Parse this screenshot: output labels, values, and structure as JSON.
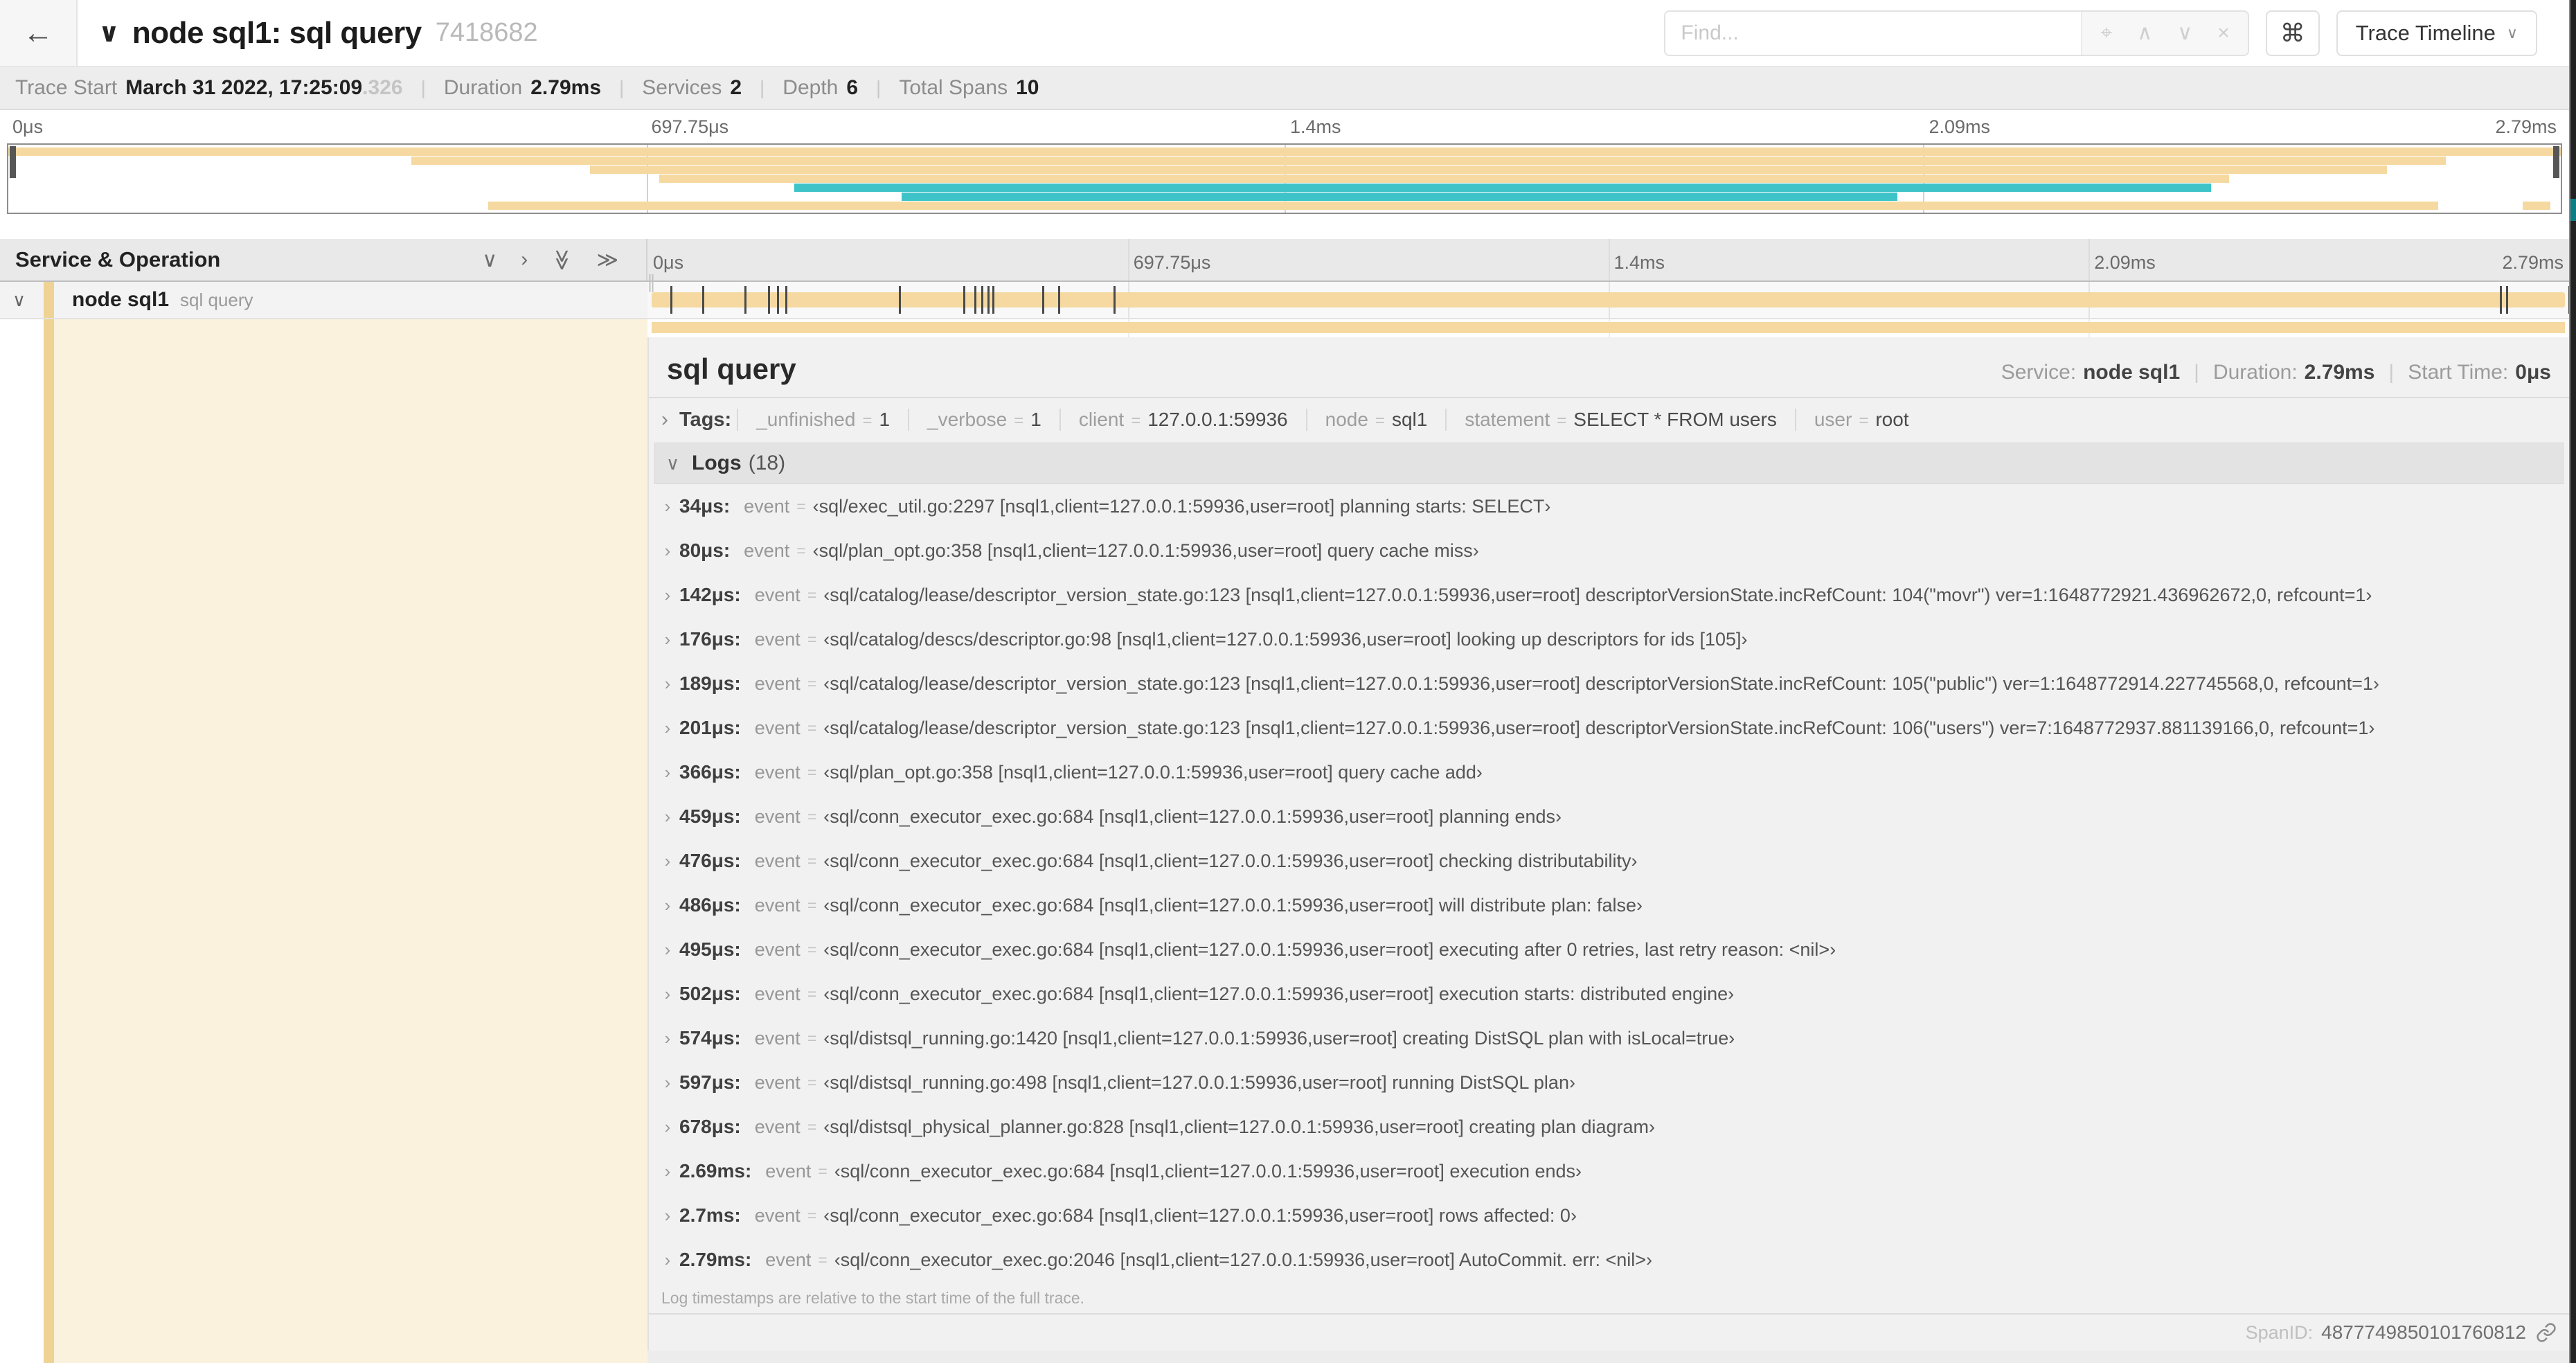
{
  "colors": {
    "tan": "#f5d9a0",
    "teal": "#3ec3c9",
    "accent_stripe": "#efd395",
    "cream_panel": "#fbf2dd"
  },
  "misc": {
    "eq": "="
  },
  "header": {
    "back_icon": "←",
    "collapse_chevron": "∨",
    "title": "node sql1: sql query",
    "trace_id": "7418682",
    "find_placeholder": "Find...",
    "focus_icon": "⌖",
    "prev_icon": "∧",
    "next_icon": "∨",
    "clear_icon": "×",
    "keyboard_shortcut_icon": "⌘",
    "view_selector_label": "Trace Timeline",
    "view_selector_caret": "∨"
  },
  "meta": {
    "items": [
      {
        "label": "Trace Start",
        "value": "March 31 2022, 17:25:09",
        "suffix": ".326"
      },
      {
        "label": "Duration",
        "value": "2.79ms",
        "suffix": ""
      },
      {
        "label": "Services",
        "value": "2",
        "suffix": ""
      },
      {
        "label": "Depth",
        "value": "6",
        "suffix": ""
      },
      {
        "label": "Total Spans",
        "value": "10",
        "suffix": ""
      }
    ]
  },
  "timeline": {
    "duration_us": 2790,
    "ticks": [
      "0μs",
      "697.75μs",
      "1.4ms",
      "2.09ms",
      "2.79ms"
    ]
  },
  "minimap": {
    "spans": [
      {
        "row": 0,
        "start": 0,
        "end": 100,
        "color": "tan"
      },
      {
        "row": 1,
        "start": 15.8,
        "end": 95.5,
        "color": "tan"
      },
      {
        "row": 2,
        "start": 22.8,
        "end": 93.2,
        "color": "tan"
      },
      {
        "row": 3,
        "start": 25.5,
        "end": 87,
        "color": "tan"
      },
      {
        "row": 4,
        "start": 30.8,
        "end": 86.3,
        "color": "teal"
      },
      {
        "row": 5,
        "start": 35,
        "end": 74,
        "color": "teal"
      },
      {
        "row": 6,
        "start": 18.8,
        "end": 95.2,
        "color": "tan"
      },
      {
        "row": 6,
        "start": 98.5,
        "end": 99.6,
        "color": "tan"
      }
    ]
  },
  "grid": {
    "header": "Service & Operation",
    "collapse_one_icon": "∨",
    "expand_one_icon": "›",
    "collapse_all_icon": "≫",
    "expand_all_icon": "≫",
    "drag_handle": "∥"
  },
  "row": {
    "chevron": "∨",
    "service": "node sql1",
    "operation": "sql query"
  },
  "span_detail": {
    "title": "sql query",
    "service_label": "Service:",
    "service": "node sql1",
    "duration_label": "Duration:",
    "duration": "2.79ms",
    "start_label": "Start Time:",
    "start": "0μs",
    "tags_chevron": "›",
    "tags_label": "Tags:",
    "tags": [
      {
        "key": "_unfinished",
        "value": "1"
      },
      {
        "key": "_verbose",
        "value": "1"
      },
      {
        "key": "client",
        "value": "127.0.0.1:59936"
      },
      {
        "key": "node",
        "value": "sql1"
      },
      {
        "key": "statement",
        "value": "SELECT * FROM users"
      },
      {
        "key": "user",
        "value": "root"
      }
    ],
    "logs_chevron": "∨",
    "logs_label": "Logs",
    "logs_count": "(18)",
    "log_row_chevron": "›",
    "logs": [
      {
        "t": "34μs:",
        "us": 34,
        "field": "event",
        "value": "‹sql/exec_util.go:2297 [nsql1,client=127.0.0.1:59936,user=root] planning starts: SELECT›"
      },
      {
        "t": "80μs:",
        "us": 80,
        "field": "event",
        "value": "‹sql/plan_opt.go:358 [nsql1,client=127.0.0.1:59936,user=root] query cache miss›"
      },
      {
        "t": "142μs:",
        "us": 142,
        "field": "event",
        "value": "‹sql/catalog/lease/descriptor_version_state.go:123 [nsql1,client=127.0.0.1:59936,user=root] descriptorVersionState.incRefCount: 104(\"movr\") ver=1:1648772921.436962672,0, refcount=1›"
      },
      {
        "t": "176μs:",
        "us": 176,
        "field": "event",
        "value": "‹sql/catalog/descs/descriptor.go:98 [nsql1,client=127.0.0.1:59936,user=root] looking up descriptors for ids [105]›"
      },
      {
        "t": "189μs:",
        "us": 189,
        "field": "event",
        "value": "‹sql/catalog/lease/descriptor_version_state.go:123 [nsql1,client=127.0.0.1:59936,user=root] descriptorVersionState.incRefCount: 105(\"public\") ver=1:1648772914.227745568,0, refcount=1›"
      },
      {
        "t": "201μs:",
        "us": 201,
        "field": "event",
        "value": "‹sql/catalog/lease/descriptor_version_state.go:123 [nsql1,client=127.0.0.1:59936,user=root] descriptorVersionState.incRefCount: 106(\"users\") ver=7:1648772937.881139166,0, refcount=1›"
      },
      {
        "t": "366μs:",
        "us": 366,
        "field": "event",
        "value": "‹sql/plan_opt.go:358 [nsql1,client=127.0.0.1:59936,user=root] query cache add›"
      },
      {
        "t": "459μs:",
        "us": 459,
        "field": "event",
        "value": "‹sql/conn_executor_exec.go:684 [nsql1,client=127.0.0.1:59936,user=root] planning ends›"
      },
      {
        "t": "476μs:",
        "us": 476,
        "field": "event",
        "value": "‹sql/conn_executor_exec.go:684 [nsql1,client=127.0.0.1:59936,user=root] checking distributability›"
      },
      {
        "t": "486μs:",
        "us": 486,
        "field": "event",
        "value": "‹sql/conn_executor_exec.go:684 [nsql1,client=127.0.0.1:59936,user=root] will distribute plan: false›"
      },
      {
        "t": "495μs:",
        "us": 495,
        "field": "event",
        "value": "‹sql/conn_executor_exec.go:684 [nsql1,client=127.0.0.1:59936,user=root] executing after 0 retries, last retry reason: <nil>›"
      },
      {
        "t": "502μs:",
        "us": 502,
        "field": "event",
        "value": "‹sql/conn_executor_exec.go:684 [nsql1,client=127.0.0.1:59936,user=root] execution starts: distributed engine›"
      },
      {
        "t": "574μs:",
        "us": 574,
        "field": "event",
        "value": "‹sql/distsql_running.go:1420 [nsql1,client=127.0.0.1:59936,user=root] creating DistSQL plan with isLocal=true›"
      },
      {
        "t": "597μs:",
        "us": 597,
        "field": "event",
        "value": "‹sql/distsql_running.go:498 [nsql1,client=127.0.0.1:59936,user=root] running DistSQL plan›"
      },
      {
        "t": "678μs:",
        "us": 678,
        "field": "event",
        "value": "‹sql/distsql_physical_planner.go:828 [nsql1,client=127.0.0.1:59936,user=root] creating plan diagram›"
      },
      {
        "t": "2.69ms:",
        "us": 2690,
        "field": "event",
        "value": "‹sql/conn_executor_exec.go:684 [nsql1,client=127.0.0.1:59936,user=root] execution ends›"
      },
      {
        "t": "2.7ms:",
        "us": 2700,
        "field": "event",
        "value": "‹sql/conn_executor_exec.go:684 [nsql1,client=127.0.0.1:59936,user=root] rows affected: 0›"
      },
      {
        "t": "2.79ms:",
        "us": 2790,
        "field": "event",
        "value": "‹sql/conn_executor_exec.go:2046 [nsql1,client=127.0.0.1:59936,user=root] AutoCommit. err: <nil>›"
      }
    ],
    "logs_note": "Log timestamps are relative to the start time of the full trace.",
    "span_id_label": "SpanID:",
    "span_id": "4877749850101760812"
  }
}
